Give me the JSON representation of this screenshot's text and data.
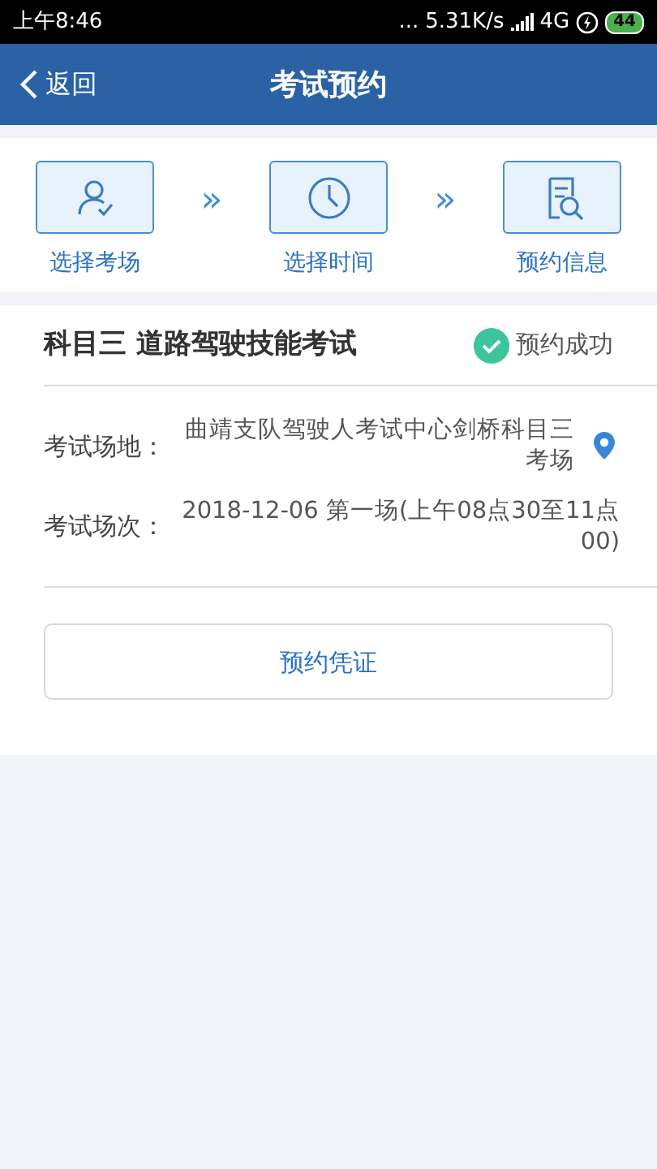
{
  "status_bar": {
    "time": "上午8:46",
    "dots": "...",
    "speed": "5.31K/s",
    "network": "4G",
    "battery": "44"
  },
  "header": {
    "back": "返回",
    "title": "考试预约"
  },
  "steps": [
    {
      "kind": "person",
      "label": "选择考场"
    },
    {
      "kind": "clock",
      "label": "选择时间"
    },
    {
      "kind": "document",
      "label": "预约信息"
    }
  ],
  "step_separator": "»",
  "exam": {
    "title": "科目三 道路驾驶技能考试",
    "status": "预约成功",
    "details": [
      {
        "kind": "location",
        "label": "考试场地：",
        "value": "曲靖支队驾驶人考试中心剑桥科目三考场"
      },
      {
        "kind": "plain",
        "label": "考试场次：",
        "value": "2018-12-06 第一场(上午08点30至11点00)"
      }
    ],
    "button": "预约凭证"
  }
}
